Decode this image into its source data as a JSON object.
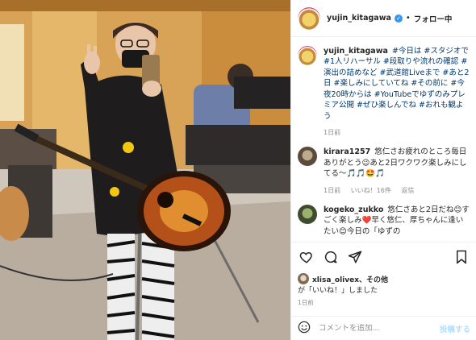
{
  "header": {
    "username": "yujin_kitagawa",
    "separator": "•",
    "follow_status": "フォロー中"
  },
  "caption": {
    "username": "yujin_kitagawa",
    "text": "#今日は #スタジオで #1人リハーサル #段取りや流れの確認 #演出の詰めなど #武道館Liveまで #あと2日 #楽しみにしていてね #その前に #今夜20時からは #YouTubeでゆずのみプレミア公開 #ぜひ楽しんでね #おれも観よう",
    "time": "1日前"
  },
  "comments": [
    {
      "username": "kirara1257",
      "text": "悠仁さお疲れのところ毎日ありがとう😉あと2日ワクワク楽しみにしてる〜🎵🎵🤩🎵",
      "time": "1日前",
      "likes": "いいね！16件",
      "reply": "返信"
    },
    {
      "username": "kogeko_zukko",
      "text": "悠仁さあと2日だね😊すごく楽しみ❤️早く悠仁、厚ちゃんに逢いたい😊今日の「ゆずの",
      "time": "",
      "likes": "",
      "reply": ""
    }
  ],
  "likes": {
    "user": "xlisa_olivex",
    "others": "、その他",
    "suffix": "が「いいね！」しました"
  },
  "post_time": "1日前",
  "comment_input": {
    "placeholder": "コメントを追加...",
    "post_label": "投稿する"
  },
  "icons": {
    "heart": "heart-icon",
    "comment": "comment-icon",
    "share": "share-icon",
    "bookmark": "bookmark-icon",
    "emoji": "emoji-icon",
    "verified": "verified-badge-icon"
  },
  "colors": {
    "link": "#00376b",
    "verified": "#3897f0",
    "muted": "#8e8e8e",
    "post_button": "#b2dffc"
  }
}
